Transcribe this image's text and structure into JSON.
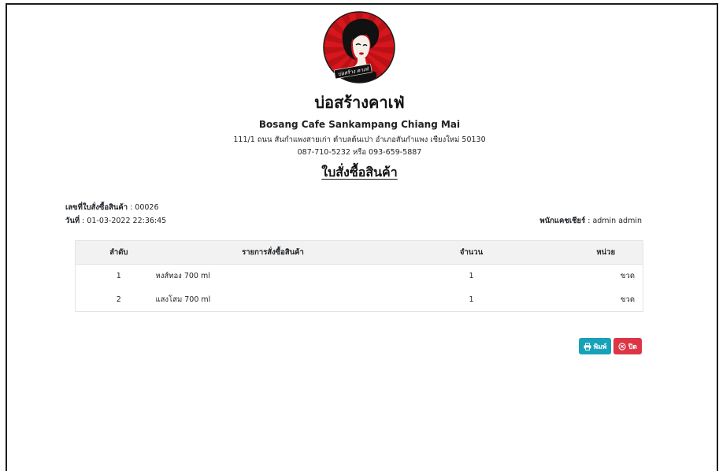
{
  "logo": {
    "text": "บ่อสร้าง คาเฟ่"
  },
  "shop": {
    "name": "บ่อสร้างคาเฟ่",
    "name_en": "Bosang Cafe Sankampang Chiang Mai",
    "address": "111/1 ถนน สันกำแพงสายเก่า ตำบลต้นเปา อำเภอสันกำแพง เชียงใหม่ 50130",
    "phone": "087-710-5232 หรือ 093-659-5887"
  },
  "document": {
    "title": "ใบสั่งซื้อสินค้า",
    "separator": ":",
    "order_no_label": "เลขที่ใบสั่งซื้อสินค้า",
    "order_no": "00026",
    "date_label": "วันที่",
    "date": "01-03-2022 22:36:45",
    "cashier_label": "พนักแคชเชียร์",
    "cashier": "admin admin"
  },
  "table": {
    "headers": [
      "ลำดับ",
      "รายการสั่งซื้อสินค้า",
      "จำนวน",
      "หน่วย"
    ],
    "rows": [
      [
        "1",
        "หงส์ทอง 700 ml",
        "1",
        "ขวด"
      ],
      [
        "2",
        "แสงโสม 700 ml",
        "1",
        "ขวด"
      ]
    ]
  },
  "actions": {
    "print": {
      "label": "พิมพ์",
      "icon": "printer-icon"
    },
    "close": {
      "label": "ปิด",
      "icon": "x-circle-icon"
    }
  },
  "colors": {
    "accent": "#17a2b8",
    "danger": "#dc3545",
    "table_header_bg": "#f2f2f2",
    "logo_red": "#d7161d"
  }
}
